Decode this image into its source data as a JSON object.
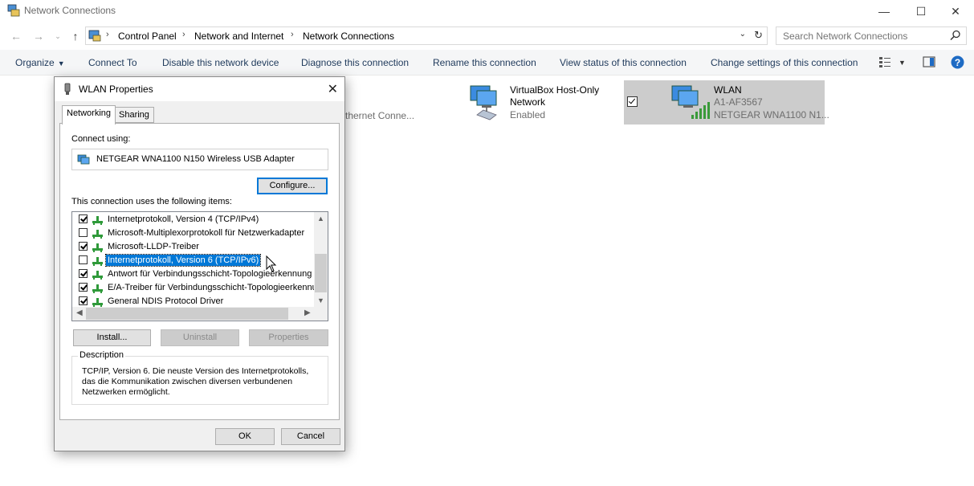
{
  "window": {
    "title": "Network Connections"
  },
  "address": {
    "crumbs": [
      "Control Panel",
      "Network and Internet",
      "Network Connections"
    ],
    "search_placeholder": "Search Network Connections"
  },
  "commands": {
    "organize": "Organize",
    "connect_to": "Connect To",
    "disable": "Disable this network device",
    "diagnose": "Diagnose this connection",
    "rename": "Rename this connection",
    "view_status": "View status of this connection",
    "change_settings": "Change settings of this connection"
  },
  "adapters": {
    "ethernet_partial": "thernet Conne...",
    "virtualbox": {
      "name_line1": "VirtualBox Host-Only",
      "name_line2": "Network",
      "status": "Enabled"
    },
    "wlan": {
      "name": "WLAN",
      "ssid": "A1-AF3567",
      "device": "NETGEAR WNA1100 N1..."
    }
  },
  "dialog": {
    "title": "WLAN Properties",
    "tabs": [
      "Networking",
      "Sharing"
    ],
    "connect_using_label": "Connect using:",
    "adapter_name": "NETGEAR WNA1100 N150 Wireless USB Adapter",
    "configure_label": "Configure...",
    "items_label": "This connection uses the following items:",
    "items": [
      {
        "label": "Internetprotokoll, Version 4 (TCP/IPv4)",
        "checked": true
      },
      {
        "label": "Microsoft-Multiplexorprotokoll für Netzwerkadapter",
        "checked": false
      },
      {
        "label": "Microsoft-LLDP-Treiber",
        "checked": true
      },
      {
        "label": "Internetprotokoll, Version 6 (TCP/IPv6)",
        "checked": false
      },
      {
        "label": "Antwort für Verbindungsschicht-Topologieerkennung",
        "checked": true
      },
      {
        "label": "E/A-Treiber für Verbindungsschicht-Topologieerkennung",
        "checked": true
      },
      {
        "label": "General NDIS Protocol Driver",
        "checked": true
      }
    ],
    "install_label": "Install...",
    "uninstall_label": "Uninstall",
    "properties_label": "Properties",
    "description_legend": "Description",
    "description_text": "TCP/IP, Version 6. Die neuste Version des Internetprotokolls, das die Kommunikation zwischen diversen verbundenen Netzwerken ermöglicht.",
    "ok_label": "OK",
    "cancel_label": "Cancel"
  },
  "colors": {
    "accent": "#0078d7",
    "command_text": "#1e395b",
    "selected_bg": "#cccccc"
  }
}
